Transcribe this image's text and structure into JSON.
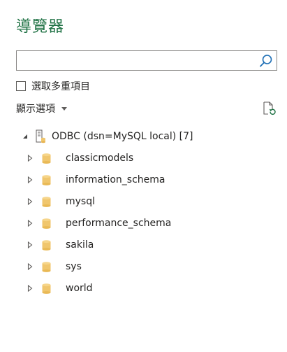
{
  "navigator": {
    "title": "導覽器",
    "search": {
      "value": "",
      "placeholder": ""
    },
    "multi_select_label": "選取多重項目",
    "display_options_label": "顯示選項",
    "icons": {
      "search": "search-icon",
      "refresh": "refresh-document-icon",
      "dropdown": "caret-down-icon",
      "server": "server-icon",
      "database": "database-icon"
    },
    "colors": {
      "title": "#217346",
      "database": "#f0c66d",
      "accent": "#217346"
    }
  },
  "tree": {
    "root": {
      "label": "ODBC (dsn=MySQL local) [7]",
      "expanded": true
    },
    "items": [
      {
        "label": "classicmodels"
      },
      {
        "label": "information_schema"
      },
      {
        "label": "mysql"
      },
      {
        "label": "performance_schema"
      },
      {
        "label": "sakila"
      },
      {
        "label": "sys"
      },
      {
        "label": "world"
      }
    ]
  }
}
